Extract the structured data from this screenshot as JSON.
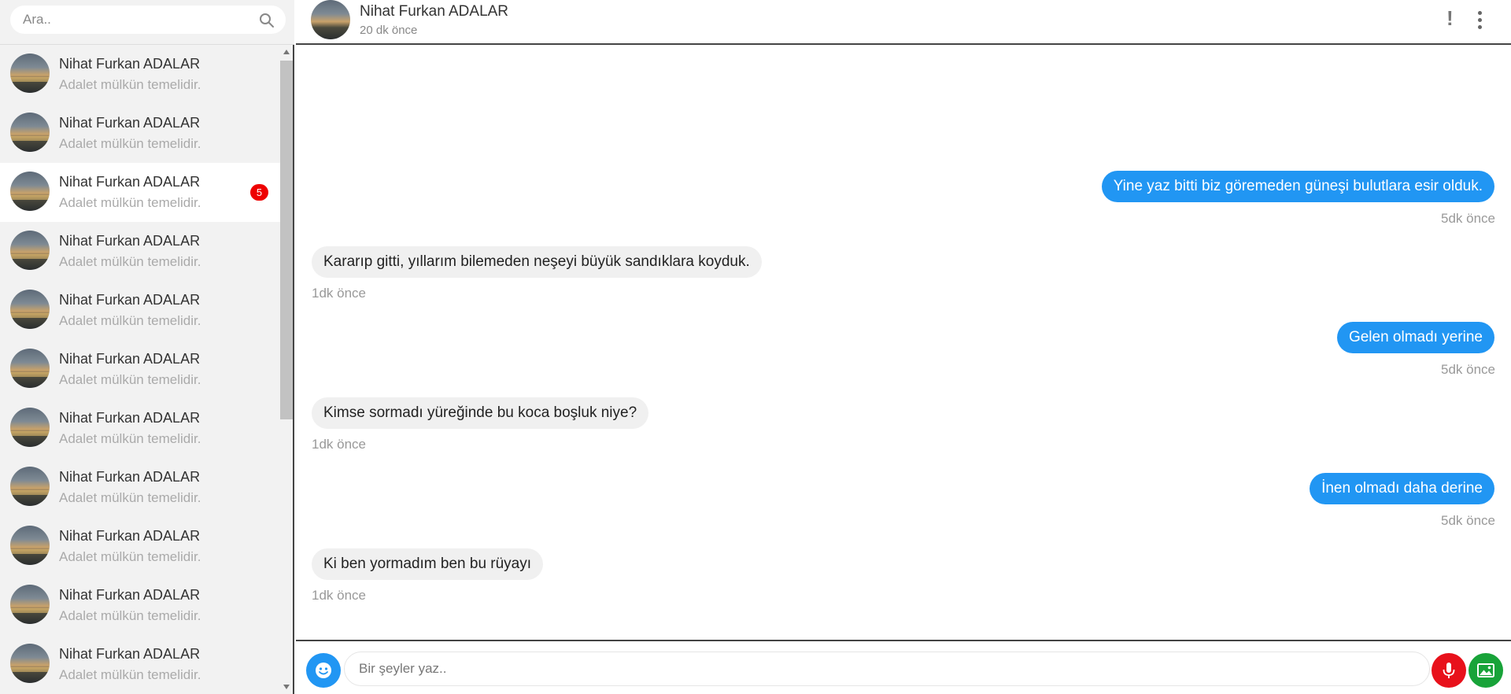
{
  "sidebar": {
    "search": {
      "placeholder": "Ara.."
    },
    "contacts": [
      {
        "name": "Nihat Furkan ADALAR",
        "message": "Adalet mülkün temelidir.",
        "badge": ""
      },
      {
        "name": "Nihat Furkan ADALAR",
        "message": "Adalet mülkün temelidir.",
        "badge": ""
      },
      {
        "name": "Nihat Furkan ADALAR",
        "message": "Adalet mülkün temelidir.",
        "badge": "5"
      },
      {
        "name": "Nihat Furkan ADALAR",
        "message": "Adalet mülkün temelidir.",
        "badge": ""
      },
      {
        "name": "Nihat Furkan ADALAR",
        "message": "Adalet mülkün temelidir.",
        "badge": ""
      },
      {
        "name": "Nihat Furkan ADALAR",
        "message": "Adalet mülkün temelidir.",
        "badge": ""
      },
      {
        "name": "Nihat Furkan ADALAR",
        "message": "Adalet mülkün temelidir.",
        "badge": ""
      },
      {
        "name": "Nihat Furkan ADALAR",
        "message": "Adalet mülkün temelidir.",
        "badge": ""
      },
      {
        "name": "Nihat Furkan ADALAR",
        "message": "Adalet mülkün temelidir.",
        "badge": ""
      },
      {
        "name": "Nihat Furkan ADALAR",
        "message": "Adalet mülkün temelidir.",
        "badge": ""
      },
      {
        "name": "Nihat Furkan ADALAR",
        "message": "Adalet mülkün temelidir.",
        "badge": ""
      }
    ]
  },
  "header": {
    "name": "Nihat Furkan ADALAR",
    "status": "20 dk önce",
    "alert_icon": "exclamation-icon",
    "more_icon": "kebab-menu-icon"
  },
  "messages": [
    {
      "direction": "out",
      "text": "Yine yaz bitti biz göremeden güneşi bulutlara esir olduk.",
      "time": "5dk önce"
    },
    {
      "direction": "in",
      "text": "Kararıp gitti, yıllarım bilemeden neşeyi büyük sandıklara koyduk.",
      "time": "1dk önce"
    },
    {
      "direction": "out",
      "text": "Gelen olmadı yerine",
      "time": "5dk önce"
    },
    {
      "direction": "in",
      "text": "Kimse sormadı yüreğinde bu koca boşluk niye?",
      "time": "1dk önce"
    },
    {
      "direction": "out",
      "text": "İnen olmadı daha derine",
      "time": "5dk önce"
    },
    {
      "direction": "in",
      "text": "Ki ben yormadım ben bu rüyayı",
      "time": "1dk önce"
    }
  ],
  "composer": {
    "placeholder": "Bir şeyler yaz..",
    "emoji_icon": "smiley-icon",
    "mic_icon": "microphone-icon",
    "image_icon": "image-icon"
  },
  "colors": {
    "accent": "#2196f3",
    "badge": "#ee0000",
    "mic": "#e8111b",
    "image_button": "#18a339",
    "sidebar_bg": "#f2f2f2"
  }
}
